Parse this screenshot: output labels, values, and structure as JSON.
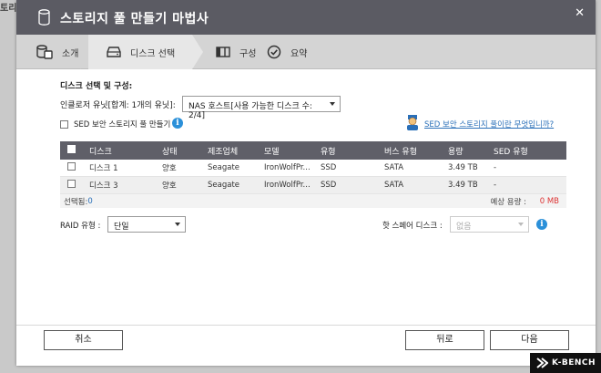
{
  "background": {
    "top_left_text": "토리"
  },
  "dialog": {
    "title": "스토리지 풀 만들기 마법사",
    "close_glyph": "✕"
  },
  "steps": [
    {
      "label": "소개",
      "icon": "database-icon"
    },
    {
      "label": "디스크 선택",
      "icon": "disk-drive-icon"
    },
    {
      "label": "구성",
      "icon": "columns-icon"
    },
    {
      "label": "요약",
      "icon": "check-circle-icon"
    }
  ],
  "disk_section": {
    "title": "디스크 선택 및 구성:",
    "enclosure_label": "인클로저 유닛[합계: 1개의 유닛]:",
    "enclosure_value": "NAS 호스트[사용 가능한 디스크 수: 2/4]",
    "sed_checkbox_label": "SED 보안 스토리지 풀 만들기",
    "sed_link": "SED 보안 스토리지 풀이란 무엇입니까?"
  },
  "table": {
    "headers": [
      "디스크",
      "상태",
      "제조업체",
      "모델",
      "유형",
      "버스 유형",
      "용량",
      "SED 유형"
    ],
    "rows": [
      [
        "디스크 1",
        "양호",
        "Seagate",
        "IronWolfPr...",
        "SSD",
        "SATA",
        "3.49 TB",
        "-"
      ],
      [
        "디스크 3",
        "양호",
        "Seagate",
        "IronWolfPr...",
        "SSD",
        "SATA",
        "3.49 TB",
        "-"
      ]
    ],
    "selected_label": "선택됨:",
    "selected_count": "0",
    "estimated_label": "예상 용량 :",
    "estimated_value": "0 MB"
  },
  "raid": {
    "label": "RAID 유형 :",
    "value": "단일",
    "hot_spare_label": "핫 스페어 디스크 :",
    "hot_spare_value": "없음"
  },
  "buttons": {
    "cancel": "취소",
    "back": "뒤로",
    "next": "다음"
  },
  "watermark": {
    "text": "K-BENCH"
  },
  "colors": {
    "title_bar": "#5b5b63",
    "step_bar": "#d4d4d4",
    "table_header": "#5f5f68",
    "link": "#2a6fb8",
    "info": "#2b90d9",
    "estimated": "#dd3333"
  }
}
